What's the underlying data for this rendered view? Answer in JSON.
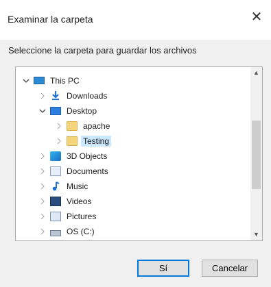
{
  "dialog": {
    "title": "Examinar la carpeta",
    "close_glyph": "✕",
    "instruction": "Seleccione la carpeta para guardar los archivos"
  },
  "tree": {
    "items": [
      {
        "label": "This PC",
        "icon": "computer-icon",
        "expanded": true,
        "level": 0
      },
      {
        "label": "Downloads",
        "icon": "downloads-icon",
        "expanded": false,
        "level": 1
      },
      {
        "label": "Desktop",
        "icon": "desktop-icon",
        "expanded": true,
        "level": 1
      },
      {
        "label": "apache",
        "icon": "folder-icon",
        "expanded": false,
        "level": 2
      },
      {
        "label": "Testing",
        "icon": "folder-icon",
        "expanded": false,
        "level": 2,
        "selected": true
      },
      {
        "label": "3D Objects",
        "icon": "3d-objects-icon",
        "expanded": false,
        "level": 1
      },
      {
        "label": "Documents",
        "icon": "documents-icon",
        "expanded": false,
        "level": 1
      },
      {
        "label": "Music",
        "icon": "music-icon",
        "expanded": false,
        "level": 1
      },
      {
        "label": "Videos",
        "icon": "videos-icon",
        "expanded": false,
        "level": 1
      },
      {
        "label": "Pictures",
        "icon": "pictures-icon",
        "expanded": false,
        "level": 1
      },
      {
        "label": "OS (C:)",
        "icon": "drive-icon",
        "expanded": false,
        "level": 1
      }
    ]
  },
  "buttons": {
    "ok": "Sí",
    "cancel": "Cancelar"
  },
  "colors": {
    "selection": "#cce8ff",
    "accent": "#0078d7"
  }
}
